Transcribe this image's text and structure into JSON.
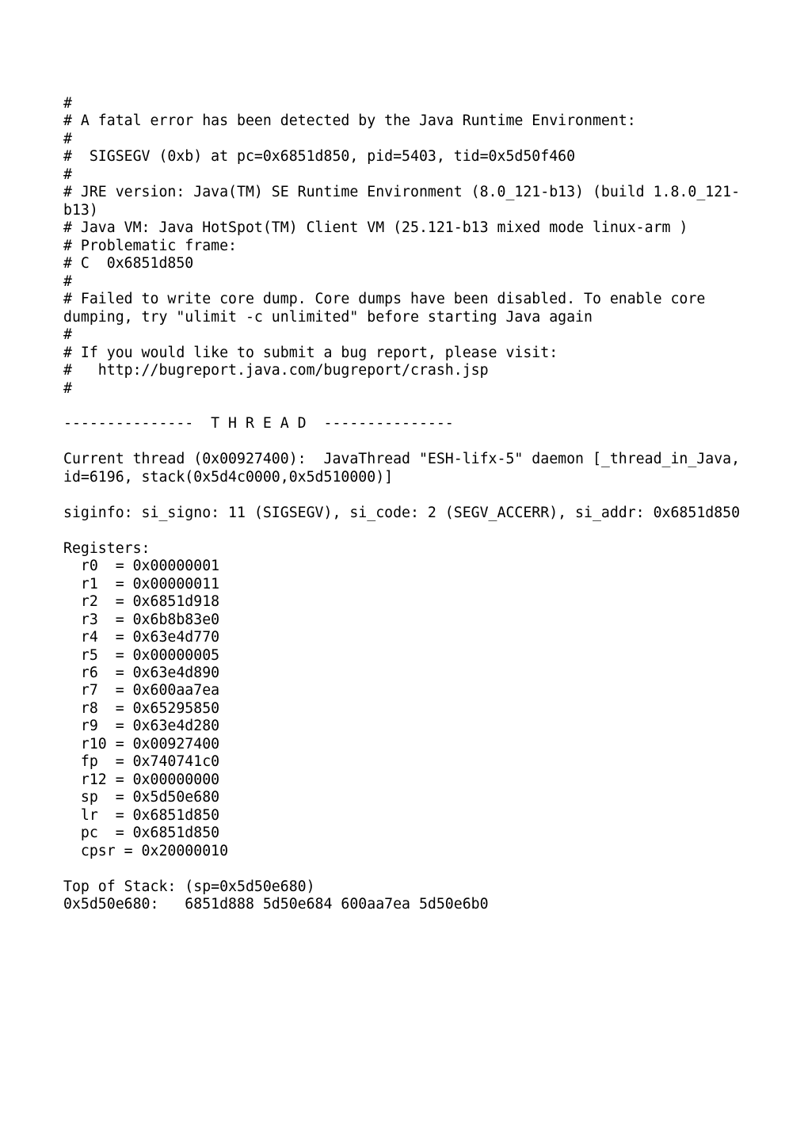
{
  "lines": [
    "#",
    "# A fatal error has been detected by the Java Runtime Environment:",
    "#",
    "#  SIGSEGV (0xb) at pc=0x6851d850, pid=5403, tid=0x5d50f460",
    "#",
    "# JRE version: Java(TM) SE Runtime Environment (8.0_121-b13) (build 1.8.0_121-b13)",
    "# Java VM: Java HotSpot(TM) Client VM (25.121-b13 mixed mode linux-arm )",
    "# Problematic frame:",
    "# C  0x6851d850",
    "#",
    "# Failed to write core dump. Core dumps have been disabled. To enable core dumping, try \"ulimit -c unlimited\" before starting Java again",
    "#",
    "# If you would like to submit a bug report, please visit:",
    "#   http://bugreport.java.com/bugreport/crash.jsp",
    "#",
    "",
    "---------------  T H R E A D  ---------------",
    "",
    "Current thread (0x00927400):  JavaThread \"ESH-lifx-5\" daemon [_thread_in_Java, id=6196, stack(0x5d4c0000,0x5d510000)]",
    "",
    "siginfo: si_signo: 11 (SIGSEGV), si_code: 2 (SEGV_ACCERR), si_addr: 0x6851d850",
    "",
    "Registers:",
    "  r0  = 0x00000001",
    "  r1  = 0x00000011",
    "  r2  = 0x6851d918",
    "  r3  = 0x6b8b83e0",
    "  r4  = 0x63e4d770",
    "  r5  = 0x00000005",
    "  r6  = 0x63e4d890",
    "  r7  = 0x600aa7ea",
    "  r8  = 0x65295850",
    "  r9  = 0x63e4d280",
    "  r10 = 0x00927400",
    "  fp  = 0x740741c0",
    "  r12 = 0x00000000",
    "  sp  = 0x5d50e680",
    "  lr  = 0x6851d850",
    "  pc  = 0x6851d850",
    "  cpsr = 0x20000010",
    "",
    "Top of Stack: (sp=0x5d50e680)",
    "0x5d50e680:   6851d888 5d50e684 600aa7ea 5d50e6b0"
  ]
}
